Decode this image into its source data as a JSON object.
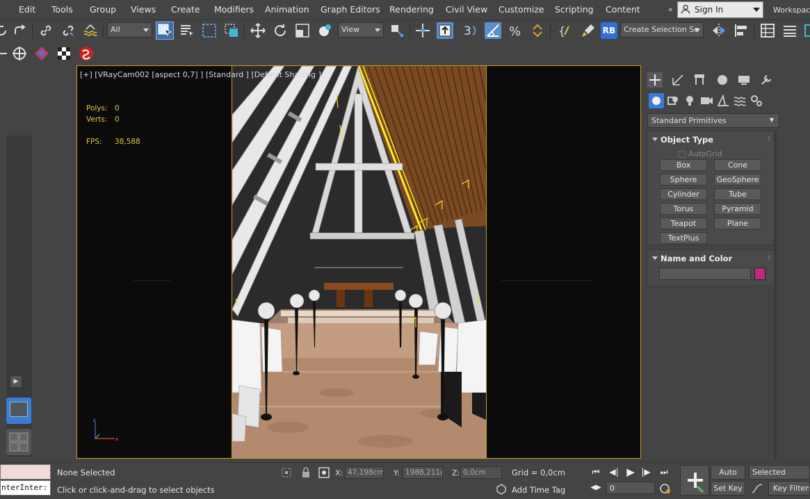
{
  "menubar": {
    "items": [
      "Edit",
      "Tools",
      "Group",
      "Views",
      "Create",
      "Modifiers",
      "Animation",
      "Graph Editors",
      "Rendering",
      "Civil View",
      "Customize",
      "Scripting",
      "Content"
    ],
    "signin_label": "Sign In",
    "workspaces_label": "Workspace"
  },
  "toolbar": {
    "filter_value": "All",
    "refcoord_value": "View",
    "rb_label": "RB",
    "selection_set_value": "Create Selection Se"
  },
  "viewport": {
    "label": "[+] [VRayCam002 [aspect 0,7] ] [Standard ] [Default Shading ]",
    "polys_label": "Polys:",
    "polys_value": "0",
    "verts_label": "Verts:",
    "verts_value": "0",
    "fps_label": "FPS:",
    "fps_value": "38,588"
  },
  "command_panel": {
    "category_value": "Standard Primitives",
    "object_type_title": "Object Type",
    "autogrid_label": "AutoGrid",
    "buttons": [
      "Box",
      "Cone",
      "Sphere",
      "GeoSphere",
      "Cylinder",
      "Tube",
      "Torus",
      "Pyramid",
      "Teapot",
      "Plane",
      "TextPlus"
    ],
    "name_color_title": "Name and Color",
    "object_color": "#c02a7a"
  },
  "statusbar": {
    "maxscript_text": "nterInter:",
    "selection_status": "None Selected",
    "prompt": "Click or click-and-drag to select objects",
    "x_label": "X:",
    "x_value": "47,198cm",
    "y_label": "Y:",
    "y_value": "1988,211cm",
    "z_label": "Z:",
    "z_value": "0,0cm",
    "grid_label": "Grid = 0,0cm",
    "add_time_tag": "Add Time Tag",
    "frame_value": "0",
    "auto_key": "Auto Key",
    "set_key": "Set Key",
    "selected_value": "Selected",
    "key_filters": "Key Filters..."
  }
}
